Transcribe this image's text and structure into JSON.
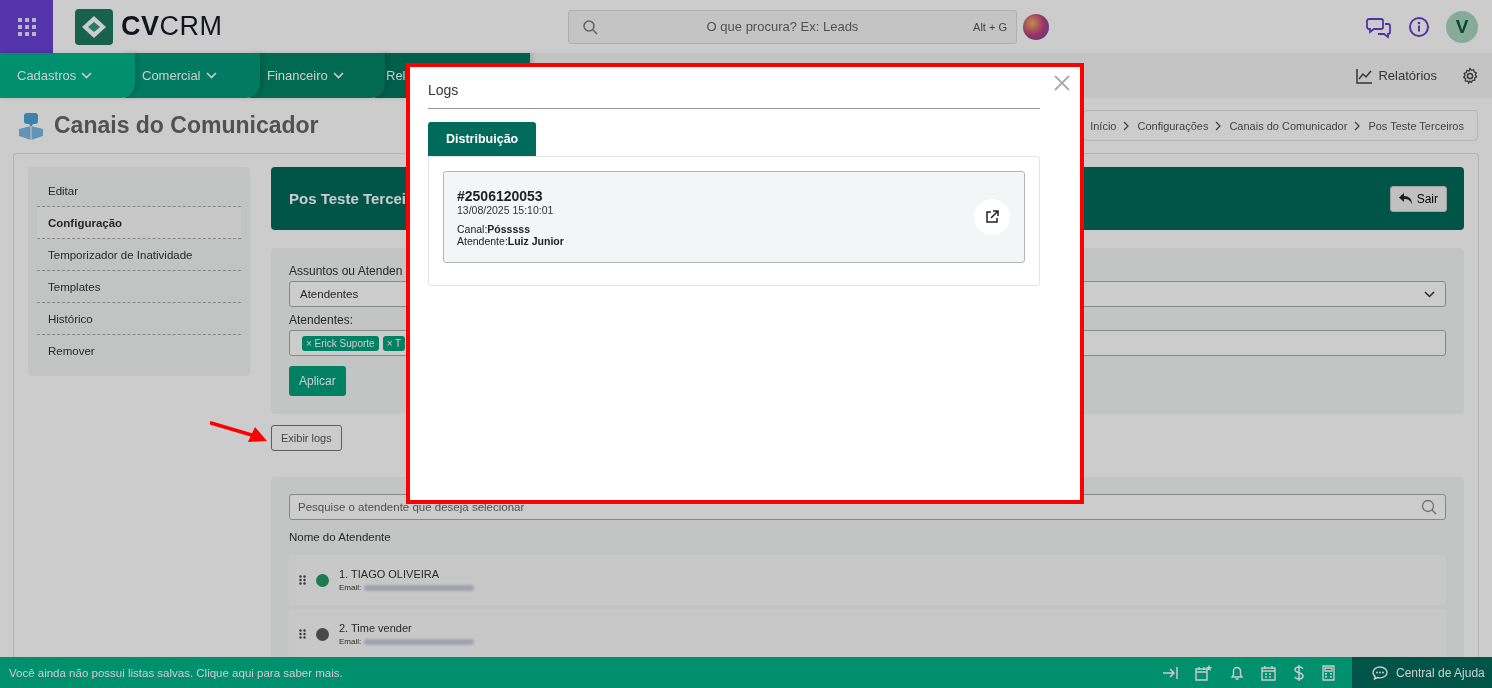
{
  "app_header": {
    "logo": "**CV**CRM",
    "search": {
      "placeholder": "O que procura? Ex: Leads",
      "shortcut": "Alt + G"
    },
    "avatar": "V"
  },
  "nav": {
    "menus": [
      {
        "label": "Cadastros"
      },
      {
        "label": "Comercial"
      },
      {
        "label": "Financeiro"
      },
      {
        "label": "Rel"
      }
    ],
    "reports": "Relatórios"
  },
  "page": {
    "title": "Canais do Comunicador",
    "breadcrumb": [
      "Início",
      "Configurações",
      "Canais do Comunicador",
      "Pos Teste Terceiros"
    ]
  },
  "sidebar": {
    "items": [
      {
        "label": "Editar",
        "selected": false
      },
      {
        "label": "Configuração",
        "selected": true
      },
      {
        "label": "Temporizador de Inatividade",
        "selected": false
      },
      {
        "label": "Templates",
        "selected": false
      },
      {
        "label": "Histórico",
        "selected": false
      },
      {
        "label": "Remover",
        "selected": false
      }
    ]
  },
  "channel_header": {
    "title": "Pos Teste Tercei",
    "exit_button": "Sair"
  },
  "form": {
    "mode_label": "Assuntos ou Atenden",
    "mode_value": "Atendentes",
    "agents_label": "Atendentes:",
    "tags": [
      "× Erick Suporte",
      "× T"
    ],
    "apply_button": "Aplicar"
  },
  "show_logs_button": "Exibir logs",
  "agents": {
    "search_placeholder": "Pesquise o atendente que deseja selecionar",
    "column": "Nome do Atendente",
    "rows": [
      {
        "name": "1. TIAGO OLIVEIRA",
        "email_label": "Email:",
        "color": "#1b7a4f"
      },
      {
        "name": "2. Time vender",
        "email_label": "Email:",
        "color": "#48494b"
      }
    ]
  },
  "status_bar": {
    "message": "Você ainda não possui listas salvas. Clique aqui para saber mais.",
    "help": "Central de Ajuda"
  },
  "modal": {
    "title": "Logs",
    "tabs": [
      {
        "label": "Distribuição",
        "selected": true
      }
    ],
    "logs": [
      {
        "id": "#2506120053",
        "datetime": "13/08/2025 15:10:01",
        "channel": "Canal:**Pósssss**",
        "agent": "Atendente:**Luiz Junior**"
      }
    ]
  }
}
